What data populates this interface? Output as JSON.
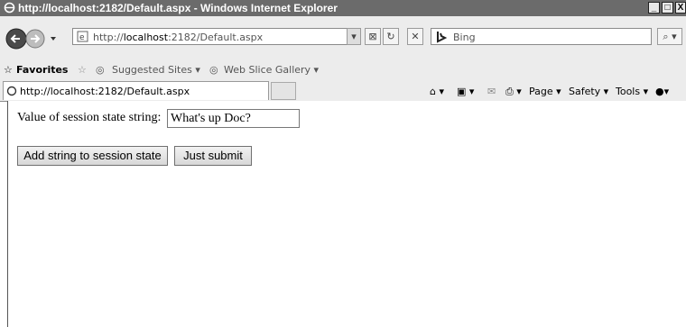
{
  "window": {
    "title": "http://localhost:2182/Default.aspx - Windows Internet Explorer"
  },
  "window_buttons": {
    "minimize": "_",
    "maximize": "□",
    "close": "X"
  },
  "nav": {
    "address_prefix": "http://",
    "address_host": "localhost",
    "address_rest": ":2182/Default.aspx",
    "search_placeholder": "Bing"
  },
  "favorites_bar": {
    "favorites_label": "Favorites",
    "suggested_sites": "Suggested Sites ▾",
    "web_slice_gallery": "Web Slice Gallery ▾"
  },
  "tab": {
    "label": "http://localhost:2182/Default.aspx"
  },
  "command_bar": {
    "page": "Page ▾",
    "safety": "Safety ▾",
    "tools": "Tools ▾",
    "help": "▾"
  },
  "form": {
    "label": "Value of session state string:",
    "input_value": "What's up Doc?",
    "add_button": "Add string to session state",
    "submit_button": "Just submit"
  }
}
